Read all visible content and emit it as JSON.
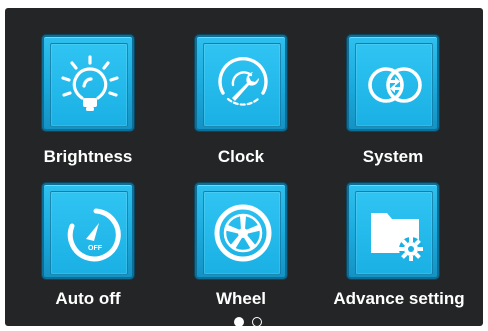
{
  "menu": {
    "items": [
      {
        "label": "Brightness",
        "icon": "brightness-bulb-icon"
      },
      {
        "label": "Clock",
        "icon": "clock-wrench-icon"
      },
      {
        "label": "System",
        "icon": "system-circles-icon"
      },
      {
        "label": "Auto off",
        "icon": "auto-off-timer-icon",
        "icon_text": "OFF"
      },
      {
        "label": "Wheel",
        "icon": "wheel-icon"
      },
      {
        "label": "Advance setting",
        "icon": "folder-gear-icon"
      }
    ]
  },
  "pager": {
    "pages": 2,
    "current": 1
  },
  "colors": {
    "background": "#232526",
    "tile": "#1fb2e6",
    "tile_border": "#0d6f98",
    "text": "#ffffff"
  }
}
